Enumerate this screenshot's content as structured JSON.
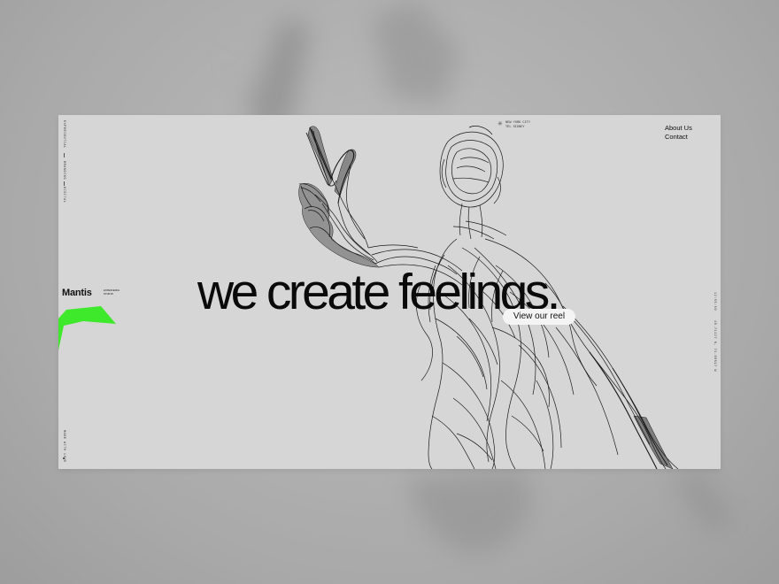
{
  "side_left": {
    "items": [
      "EXPERIENTIAL",
      "BRANDING",
      "DIGITAL"
    ],
    "bottom": "MADE WITH LOVE"
  },
  "brand": {
    "name": "Mantis",
    "sub_line1": "EXPERIENCE",
    "sub_line2": "STUDIO",
    "accent_color": "#3ee82a"
  },
  "location": {
    "line1": "NEW YORK CITY",
    "line2": "TEL SIDNEY"
  },
  "nav": {
    "about": "About Us",
    "contact": "Contact"
  },
  "hero": {
    "headline": "we create feelings.",
    "reel_button": "View our reel"
  },
  "side_right": {
    "time": "12:55:50",
    "coords": "40.71427 N, 74.00597 W"
  },
  "icons": {
    "location": "sun-icon"
  }
}
